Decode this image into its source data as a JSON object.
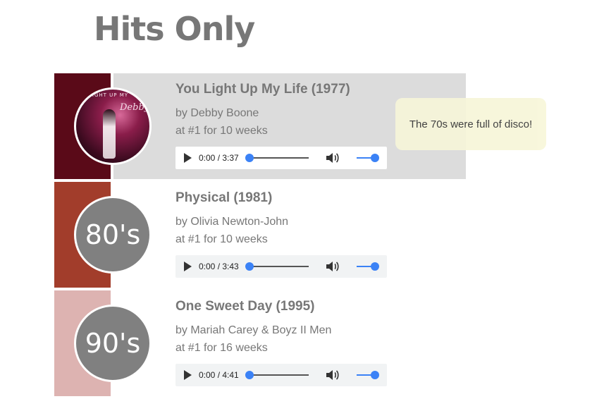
{
  "page": {
    "title": "Hits Only"
  },
  "songs": [
    {
      "title": "You Light Up My Life (1977)",
      "artist": "by Debby Boone",
      "chart_run": "at #1 for 10 weeks",
      "badge_label": "",
      "stripe_color": "#5a0a18",
      "active": true,
      "player": {
        "time": "0:00 / 3:37",
        "progress": 0,
        "volume": 1
      },
      "cover": {
        "top_text": "LIGHT UP MY",
        "script_text": "Debby"
      }
    },
    {
      "title": "Physical (1981)",
      "artist": "by Olivia Newton-John",
      "chart_run": "at #1 for 10 weeks",
      "badge_label": "80's",
      "stripe_color": "#a23d2b",
      "active": false,
      "player": {
        "time": "0:00 / 3:43",
        "progress": 0,
        "volume": 1
      }
    },
    {
      "title": "One Sweet Day (1995)",
      "artist": "by Mariah Carey & Boyz II Men",
      "chart_run": "at #1 for 16 weeks",
      "badge_label": "90's",
      "stripe_color": "#ddb3b1",
      "active": false,
      "player": {
        "time": "0:00 / 4:41",
        "progress": 0,
        "volume": 1
      }
    }
  ],
  "tooltip": {
    "text": "The 70s were full of disco!"
  },
  "icons": {
    "play": "play-icon",
    "volume": "volume-icon"
  },
  "colors": {
    "accent": "#3b82f6",
    "tooltip_bg": "#f7f6d9",
    "active_row_bg": "#dcdcdc",
    "text": "#777777"
  }
}
